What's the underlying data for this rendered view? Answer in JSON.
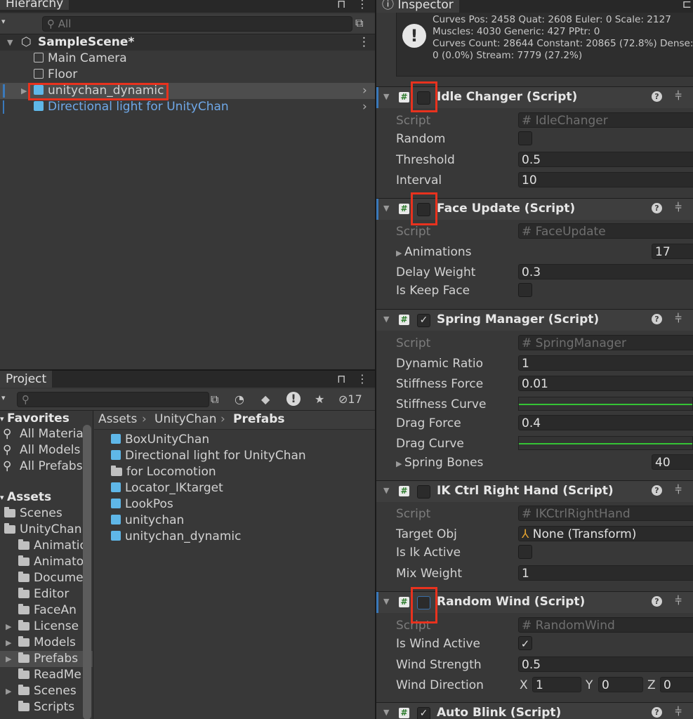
{
  "hierarchy": {
    "tab_label": "Hierarchy",
    "search_placeholder": "All",
    "scene": "SampleScene*",
    "items": [
      {
        "label": "Main Camera"
      },
      {
        "label": "Floor"
      },
      {
        "label": "unitychan_dynamic"
      },
      {
        "label": "Directional light for UnityChan"
      }
    ]
  },
  "project": {
    "tab_label": "Project",
    "hidden_count": "17",
    "favorites_label": "Favorites",
    "favorites": [
      "All Materia",
      "All Models",
      "All Prefabs"
    ],
    "assets_label": "Assets",
    "tree": [
      "Scenes",
      "UnityChan",
      "Animatio",
      "Animato",
      "Docume",
      "Editor",
      "FaceAn",
      "License",
      "Models",
      "Prefabs",
      "ReadMe",
      "Scenes",
      "Scripts"
    ],
    "breadcrumb": {
      "p1": "Assets",
      "p2": "UnityChan",
      "p3": "Prefabs"
    },
    "files": [
      "BoxUnityChan",
      "Directional light for UnityChan",
      "for Locomotion",
      "Locator_IKtarget",
      "LookPos",
      "unitychan",
      "unitychan_dynamic"
    ]
  },
  "inspector": {
    "tab_label": "Inspector",
    "info_lines": [
      "Curves Pos: 2458 Quat: 2608 Euler: 0 Scale: 2127",
      "Muscles: 4030 Generic: 427 PPtr: 0",
      "Curves Count: 28644 Constant: 20865 (72.8%) Dense:",
      "0 (0.0%) Stream: 7779 (27.2%)"
    ],
    "idle_changer": {
      "title": "Idle Changer (Script)",
      "script_label": "Script",
      "script": "IdleChanger",
      "random_label": "Random",
      "threshold_label": "Threshold",
      "threshold": "0.5",
      "interval_label": "Interval",
      "interval": "10"
    },
    "face_update": {
      "title": "Face Update (Script)",
      "script_label": "Script",
      "script": "FaceUpdate",
      "animations_label": "Animations",
      "animations": "17",
      "delay_label": "Delay Weight",
      "delay": "0.3",
      "keep_label": "Is Keep Face"
    },
    "spring_manager": {
      "title": "Spring Manager (Script)",
      "script_label": "Script",
      "script": "SpringManager",
      "dyn_label": "Dynamic Ratio",
      "dyn": "1",
      "stiff_label": "Stiffness Force",
      "stiff": "0.01",
      "stiff_curve_label": "Stiffness Curve",
      "drag_label": "Drag Force",
      "drag": "0.4",
      "drag_curve_label": "Drag Curve",
      "bones_label": "Spring Bones",
      "bones": "40"
    },
    "ik_ctrl": {
      "title": "IK Ctrl Right Hand (Script)",
      "script_label": "Script",
      "script": "IKCtrlRightHand",
      "target_label": "Target Obj",
      "target": "None (Transform)",
      "active_label": "Is Ik Active",
      "mix_label": "Mix Weight",
      "mix": "1"
    },
    "random_wind": {
      "title": "Random Wind (Script)",
      "script_label": "Script",
      "script": "RandomWind",
      "active_label": "Is Wind Active",
      "strength_label": "Wind Strength",
      "strength": "0.5",
      "direction_label": "Wind Direction",
      "x_label": "X",
      "x": "1",
      "y_label": "Y",
      "y": "0",
      "z_label": "Z",
      "z": "0"
    },
    "auto_blink": {
      "title": "Auto Blink (Script)"
    }
  },
  "colors": {
    "highlight": "#e8321e",
    "selection": "#4d4d4d",
    "prefab_blue": "#5fb7e8",
    "curve_green": "#35c435"
  }
}
